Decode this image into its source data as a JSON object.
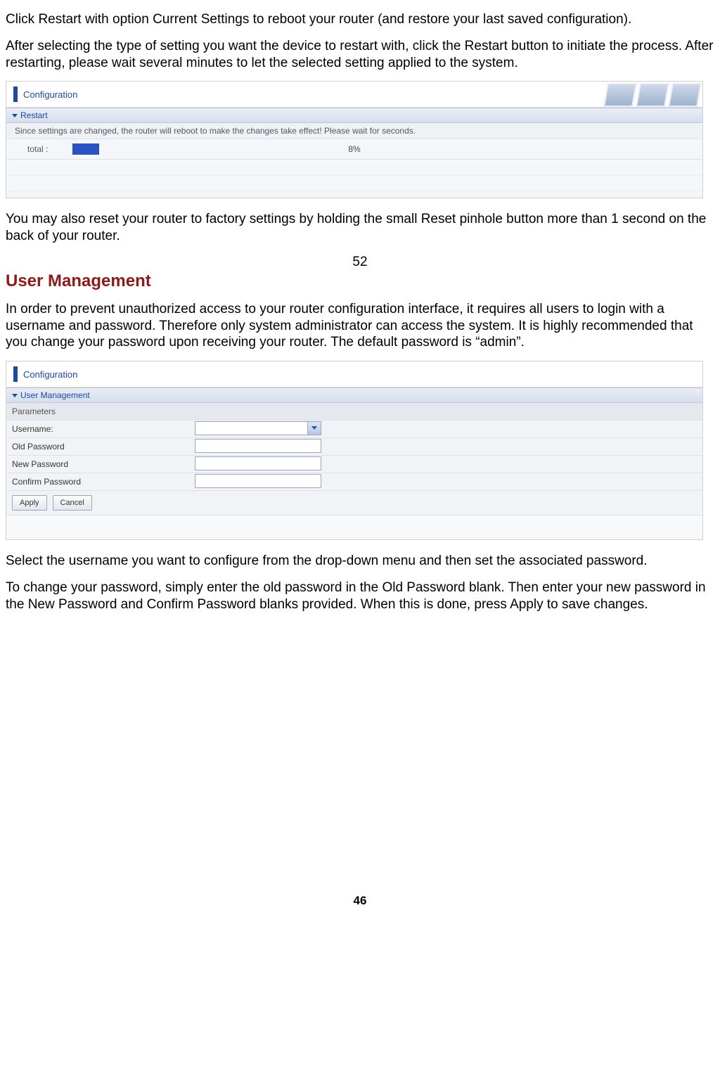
{
  "paragraphs": {
    "p1": "Click Restart with option Current Settings to reboot your router (and restore your last saved configuration).",
    "p2": "After selecting the type of setting you want the device to restart with, click the Restart button to initiate the process. After restarting, please wait several minutes to let the selected setting applied to the system.",
    "p3": "You may also reset your router to factory settings by holding the small Reset pinhole button more than 1 second on the back of your router.",
    "mid_number": "52",
    "heading": "User Management",
    "p4": "In order to prevent unauthorized access to your router configuration interface, it requires all users to login with a username and password. Therefore only system administrator can access the system. It is highly recommended that you change your password upon receiving your router. The default password is “admin”.",
    "p5": "Select the username you want to configure from the drop-down menu and then set the associated password.",
    "p6": "To change your password, simply enter the old password in the Old Password blank. Then enter your new password in the New Password and Confirm Password blanks provided. When this is done, press Apply to save changes.",
    "page_number": "46"
  },
  "shot1": {
    "config_title": "Configuration",
    "section": "Restart",
    "info": "Since settings are changed, the router will reboot to make the changes take effect! Please wait for seconds.",
    "total_label": "total :",
    "percent": "8%"
  },
  "shot2": {
    "config_title": "Configuration",
    "section": "User Management",
    "subheader": "Parameters",
    "rows": {
      "username_label": "Username:",
      "oldpw_label": "Old Password",
      "newpw_label": "New Password",
      "confirmpw_label": "Confirm Password"
    },
    "buttons": {
      "apply": "Apply",
      "cancel": "Cancel"
    }
  }
}
